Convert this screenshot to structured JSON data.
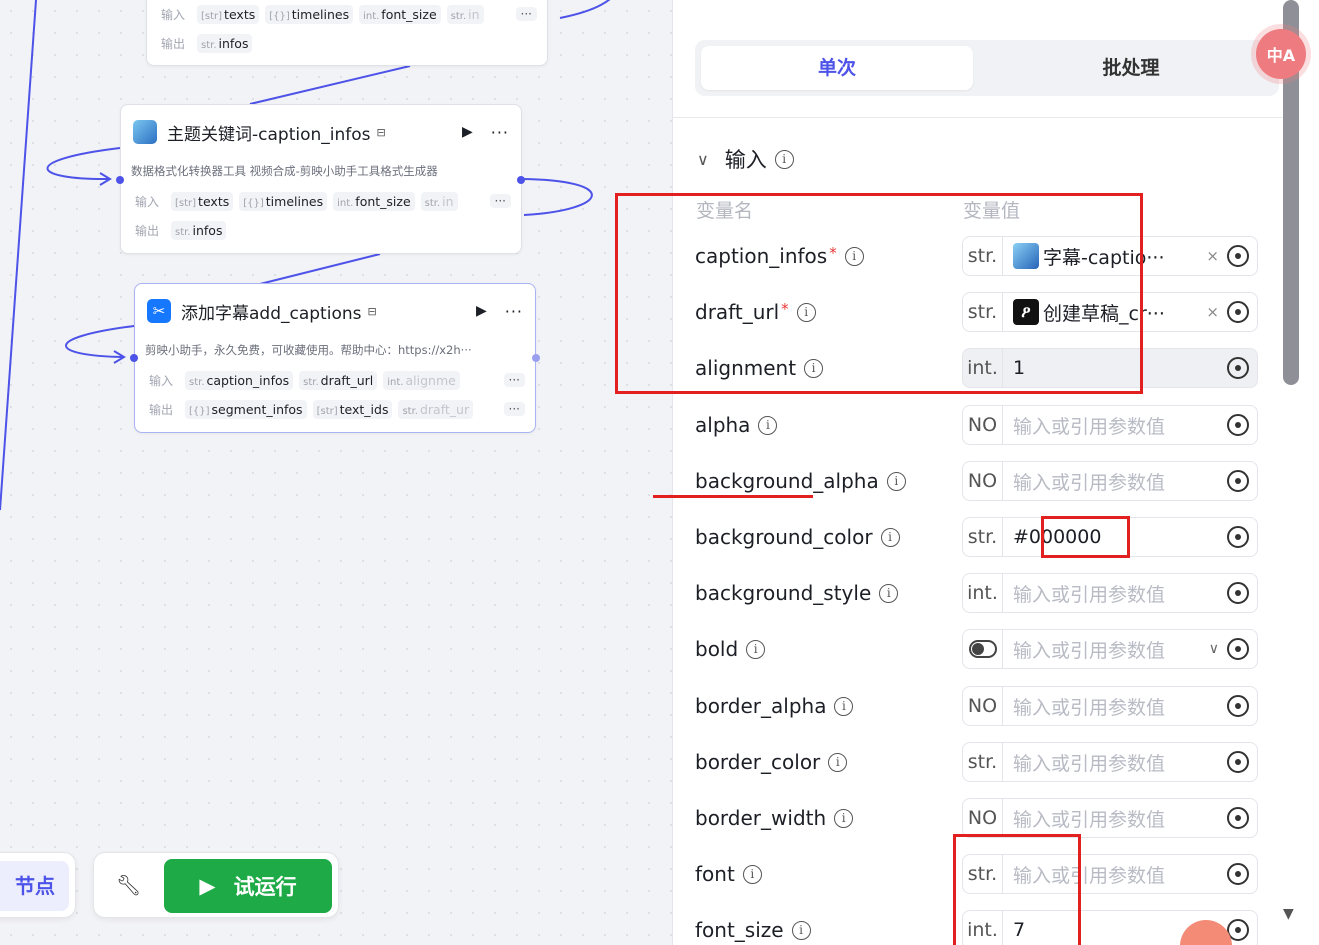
{
  "canvas": {
    "node_top": {
      "input_label": "输入",
      "output_label": "输出",
      "inputs": [
        {
          "type": "[str]",
          "name": "texts"
        },
        {
          "type": "[{}]",
          "name": "timelines"
        },
        {
          "type": "int.",
          "name": "font_size"
        },
        {
          "type": "str.",
          "name": "in"
        }
      ],
      "more": "···",
      "outputs": [
        {
          "type": "str.",
          "name": "infos"
        }
      ]
    },
    "node_keywords": {
      "title": "主题关键词-caption_infos",
      "tag_icon": "template-icon",
      "description": "数据格式化转换器工具 视频合成-剪映小助手工具格式生成器",
      "input_label": "输入",
      "output_label": "输出",
      "inputs": [
        {
          "type": "[str]",
          "name": "texts"
        },
        {
          "type": "[{}]",
          "name": "timelines"
        },
        {
          "type": "int.",
          "name": "font_size"
        },
        {
          "type": "str.",
          "name": "in"
        }
      ],
      "more": "···",
      "outputs": [
        {
          "type": "str.",
          "name": "infos"
        }
      ]
    },
    "node_captions": {
      "title": "添加字幕add_captions",
      "description": "剪映小助手，永久免费，可收藏使用。帮助中心：https://x2h···",
      "input_label": "输入",
      "output_label": "输出",
      "inputs": [
        {
          "type": "str.",
          "name": "caption_infos"
        },
        {
          "type": "str.",
          "name": "draft_url"
        },
        {
          "type": "int.",
          "name": "alignme"
        }
      ],
      "outputs": [
        {
          "type": "[{}]",
          "name": "segment_infos"
        },
        {
          "type": "[str]",
          "name": "text_ids"
        },
        {
          "type": "str.",
          "name": "draft_ur"
        }
      ],
      "more": "···"
    },
    "toolbar": {
      "add_node_label": "节点",
      "test_run_label": "试运行"
    }
  },
  "panel": {
    "tabs": [
      "单次",
      "批处理"
    ],
    "section_title": "输入",
    "col_name": "变量名",
    "col_value": "变量值",
    "params": [
      {
        "name": "caption_infos",
        "required": true,
        "type": "str.",
        "value": "字幕-captio···",
        "ref": "img",
        "clear": true
      },
      {
        "name": "draft_url",
        "required": true,
        "type": "str.",
        "value": "创建草稿_cr···",
        "ref": "jy",
        "clear": true
      },
      {
        "name": "alignment",
        "required": false,
        "type": "int.",
        "value": "1",
        "filled": true
      },
      {
        "name": "alpha",
        "required": false,
        "type": "NO",
        "placeholder": "输入或引用参数值"
      },
      {
        "name": "background_alpha",
        "required": false,
        "type": "NO",
        "placeholder": "输入或引用参数值"
      },
      {
        "name": "background_color",
        "required": false,
        "type": "str.",
        "value": "#000000"
      },
      {
        "name": "background_style",
        "required": false,
        "type": "int.",
        "placeholder": "输入或引用参数值"
      },
      {
        "name": "bold",
        "required": false,
        "type": "toggle",
        "placeholder": "输入或引用参数值",
        "dropdown": true
      },
      {
        "name": "border_alpha",
        "required": false,
        "type": "NO",
        "placeholder": "输入或引用参数值"
      },
      {
        "name": "border_color",
        "required": false,
        "type": "str.",
        "placeholder": "输入或引用参数值"
      },
      {
        "name": "border_width",
        "required": false,
        "type": "NO",
        "placeholder": "输入或引用参数值"
      },
      {
        "name": "font",
        "required": false,
        "type": "str.",
        "placeholder": "输入或引用参数值"
      },
      {
        "name": "font_size",
        "required": false,
        "type": "int.",
        "value": "7"
      }
    ]
  },
  "misc": {
    "avatar_text": "中A",
    "clear_icon": "×",
    "required_mark": "*",
    "info_icon": "i",
    "accent_color": "#4d53e8",
    "run_color": "#1eaa46",
    "annotation_color": "#e32020"
  }
}
